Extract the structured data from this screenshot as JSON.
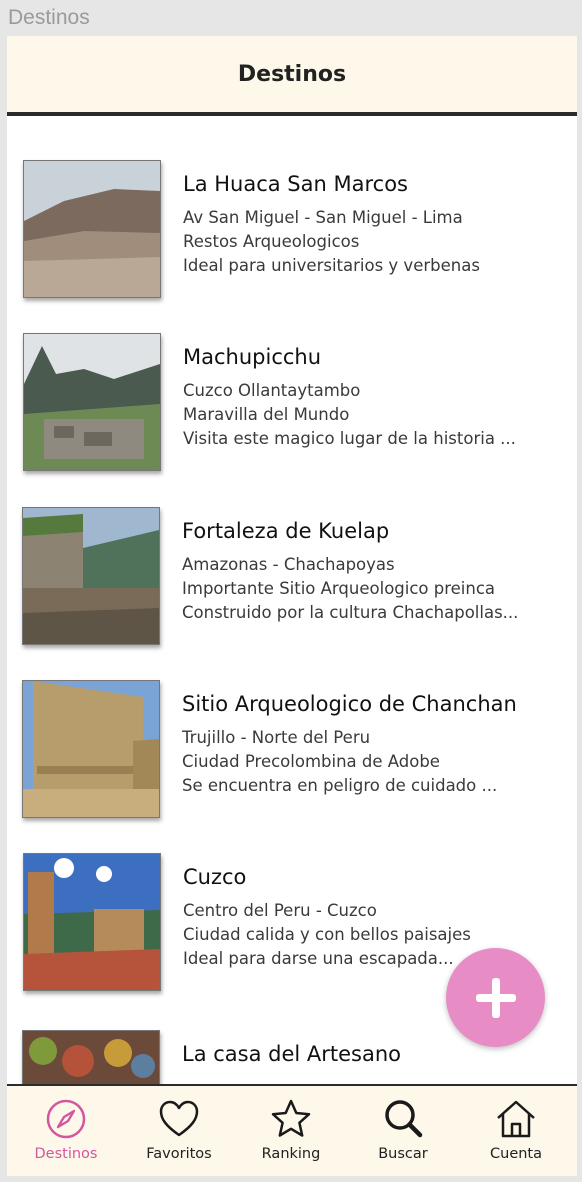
{
  "window": {
    "title": "Destinos"
  },
  "header": {
    "title": "Destinos"
  },
  "destinations": [
    {
      "name": "La Huaca San Marcos",
      "line1": "Av San Miguel - San Miguel - Lima",
      "line2": "Restos Arqueologicos",
      "line3": "Ideal para universitarios y verbenas"
    },
    {
      "name": "Machupicchu",
      "line1": "Cuzco Ollantaytambo",
      "line2": "Maravilla del Mundo",
      "line3": "Visita este magico lugar de la historia ..."
    },
    {
      "name": "Fortaleza de Kuelap",
      "line1": "Amazonas - Chachapoyas",
      "line2": "Importante Sitio Arqueologico preinca",
      "line3": "Construido por la cultura Chachapollas..."
    },
    {
      "name": "Sitio Arqueologico de Chanchan",
      "line1": "Trujillo - Norte del Peru",
      "line2": "Ciudad Precolombina de Adobe",
      "line3": "Se encuentra en peligro de cuidado ..."
    },
    {
      "name": "Cuzco",
      "line1": "Centro del Peru - Cuzco",
      "line2": "Ciudad calida y con bellos paisajes",
      "line3": "Ideal para darse una escapada..."
    },
    {
      "name": "La casa del Artesano",
      "line1": "",
      "line2": "",
      "line3": ""
    }
  ],
  "tabs": [
    {
      "label": "Destinos",
      "icon": "compass-icon"
    },
    {
      "label": "Favoritos",
      "icon": "heart-icon"
    },
    {
      "label": "Ranking",
      "icon": "star-icon"
    },
    {
      "label": "Buscar",
      "icon": "search-icon"
    },
    {
      "label": "Cuenta",
      "icon": "home-icon"
    }
  ],
  "colors": {
    "accent": "#e78cc4",
    "active_tab": "#d4569e",
    "header_bg": "#fdf8ea"
  }
}
